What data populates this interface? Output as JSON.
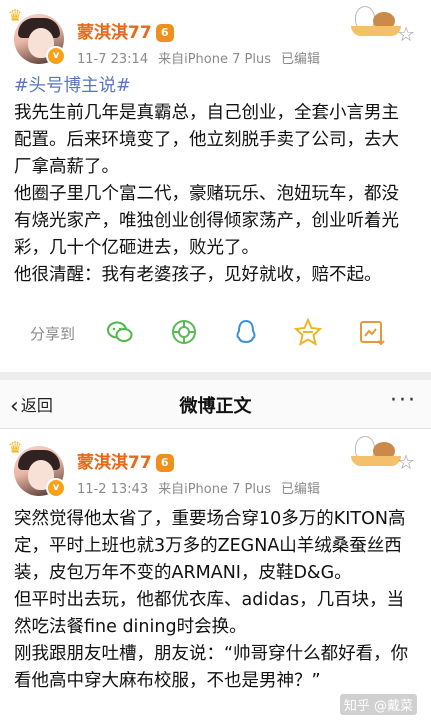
{
  "post1": {
    "username": "蒙淇淇77",
    "vip_badge": "6",
    "date": "11-7 23:14",
    "source": "来自iPhone 7 Plus",
    "edited": "已编辑",
    "hashtag": "#头号博主说#",
    "paragraphs": [
      "我先生前几年是真霸总，自己创业，全套小言男主配置。后来环境变了，他立刻脱手卖了公司，去大厂拿高薪了。",
      "他圈子里几个富二代，豪赌玩乐、泡妞玩车，都没有烧光家产，唯独创业创得倾家荡产，创业听着光彩，几十个亿砸进去，败光了。",
      "他很清醒：我有老婆孩子，见好就收，赔不起。"
    ],
    "share_label": "分享到",
    "share_icons": [
      "wechat-icon",
      "moments-icon",
      "qq-icon",
      "qzone-icon",
      "save-image-icon"
    ]
  },
  "navbar": {
    "back_label": "返回",
    "title": "微博正文",
    "more": "···"
  },
  "post2": {
    "username": "蒙淇淇77",
    "vip_badge": "6",
    "date": "11-2 13:43",
    "source": "来自iPhone 7 Plus",
    "edited": "已编辑",
    "paragraphs": [
      "突然觉得他太省了，重要场合穿10多万的KITON高定，平时上班也就3万多的ZEGNA山羊绒桑蚕丝西装，皮包万年不变的ARMANI，皮鞋D&G。",
      "但平时出去玩，他都优衣库、adidas，几百块，当然吃法餐fine dining时会换。",
      "刚我跟朋友吐槽，朋友说：“帅哥穿什么都好看，你看他高中穿大麻布校服，不也是男神？”"
    ]
  },
  "watermark": "知乎 @戴菜",
  "colors": {
    "username": "#e8681a",
    "hashtag": "#5a76c2",
    "meta": "#8a8a8a",
    "divider": "#ededed"
  }
}
